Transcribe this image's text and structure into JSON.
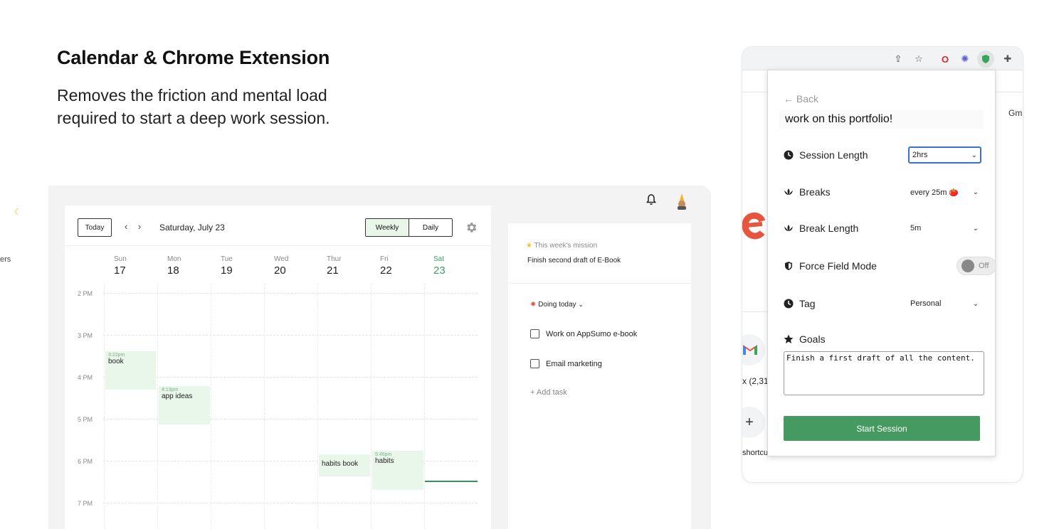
{
  "hero": {
    "title": "Calendar & Chrome Extension",
    "subtitle": "Removes the friction and mental load required to start a deep work session."
  },
  "app": {
    "left_strip_text": "ers",
    "calendar": {
      "today_button": "Today",
      "prev_label": "‹",
      "next_label": "›",
      "date_label": "Saturday, July 23",
      "views": {
        "weekly": "Weekly",
        "daily": "Daily",
        "active": "Weekly"
      },
      "days": [
        {
          "name": "Sun",
          "num": "17"
        },
        {
          "name": "Mon",
          "num": "18"
        },
        {
          "name": "Tue",
          "num": "19"
        },
        {
          "name": "Wed",
          "num": "20"
        },
        {
          "name": "Thur",
          "num": "21"
        },
        {
          "name": "Fri",
          "num": "22"
        },
        {
          "name": "Sat",
          "num": "23",
          "today": true
        }
      ],
      "hours": [
        "2 PM",
        "3 PM",
        "4 PM",
        "5 PM",
        "6 PM",
        "7 PM"
      ],
      "events": [
        {
          "time": "3:22pm",
          "title": "book",
          "day": "Sun"
        },
        {
          "time": "4:13pm",
          "title": "app ideas",
          "day": "Mon"
        },
        {
          "time": "",
          "title": "habits book",
          "day": "Thur"
        },
        {
          "time": "5:46pm",
          "title": "habits",
          "day": "Fri"
        }
      ]
    },
    "sidebar": {
      "mission_label": "This week's mission",
      "mission_text": "Finish second draft of E-Book",
      "doing_today": "Doing today",
      "tasks": [
        "Work on AppSumo e-book",
        "Email marketing"
      ],
      "add_task": "Add task"
    }
  },
  "browser": {
    "gm_text": "Gm",
    "count_text": "x (2,31¢",
    "shortcut_text": "shortcu"
  },
  "extension": {
    "back": "← Back",
    "session_title": "work on this portfolio!",
    "options": {
      "session_length": {
        "label": "Session Length",
        "value": "2hrs"
      },
      "breaks": {
        "label": "Breaks",
        "value": "every 25m 🍅"
      },
      "break_length": {
        "label": "Break Length",
        "value": "5m"
      },
      "force_field": {
        "label": "Force Field Mode",
        "value": "Off"
      },
      "tag": {
        "label": "Tag",
        "value": "Personal"
      },
      "goals": {
        "label": "Goals",
        "value": "Finish a first draft of all the content."
      }
    },
    "start_button": "Start Session"
  },
  "colors": {
    "accent_green": "#449a60",
    "event_bg": "#e9f6ea",
    "today_green": "#3aa35a",
    "select_focus": "#3c6fd6"
  }
}
